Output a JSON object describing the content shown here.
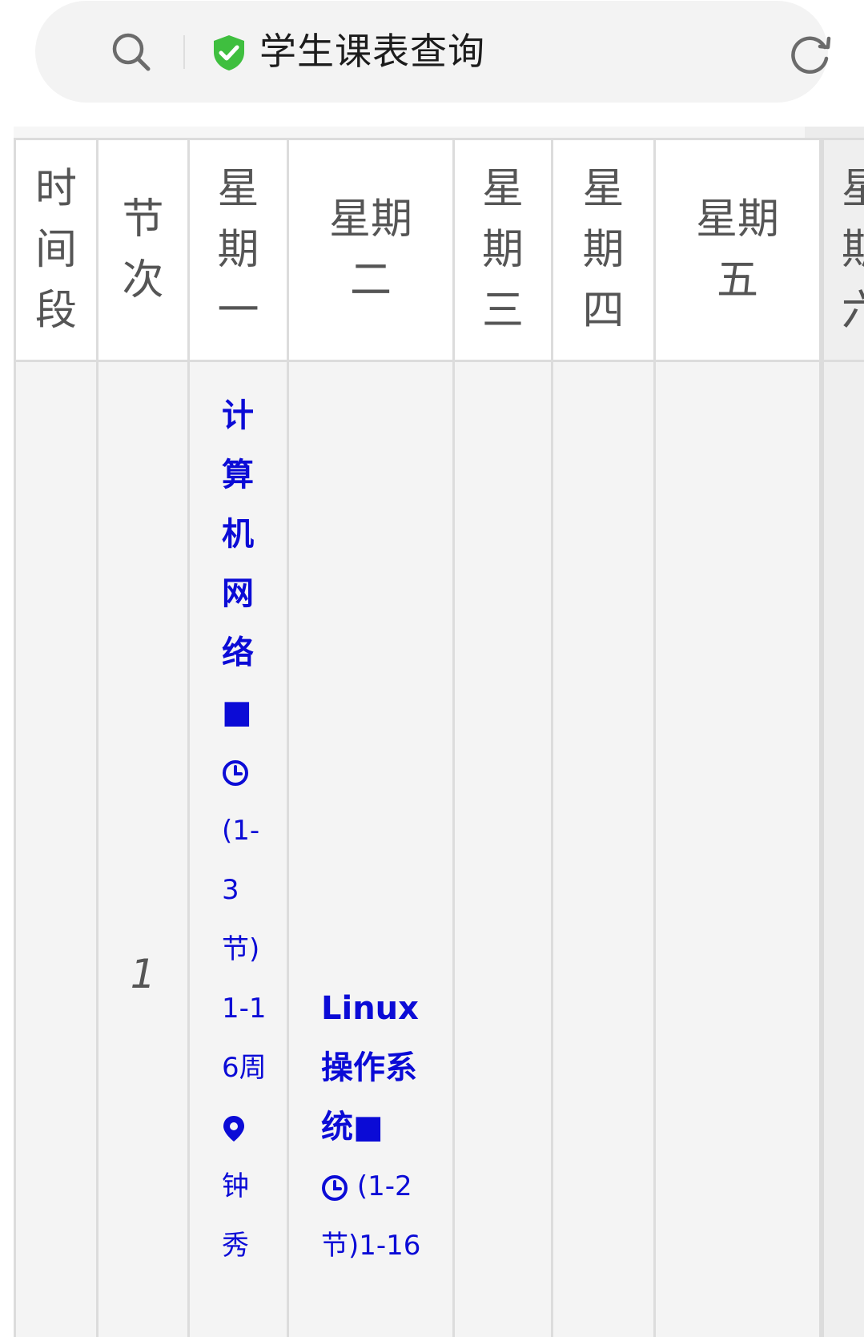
{
  "browser": {
    "page_title": "学生课表查询",
    "icons": [
      "search-icon",
      "shield-check-icon",
      "refresh-icon"
    ],
    "secure_color": "#3fbf3f"
  },
  "timetable": {
    "headers": [
      "时间段",
      "节次",
      "星期一",
      "星期二",
      "星期三",
      "星期四",
      "星期五",
      "星期六"
    ],
    "rows": [
      {
        "period": "1",
        "monday": {
          "course": "计算机网络■",
          "time_prefix": "(1-3节)",
          "weeks": "1-16周",
          "location": "钟秀"
        },
        "tuesday": {
          "course": "Linux操作系统■",
          "time_prefix": "(1-2节)1-16"
        }
      }
    ],
    "course_color": "#0b0bd6"
  }
}
